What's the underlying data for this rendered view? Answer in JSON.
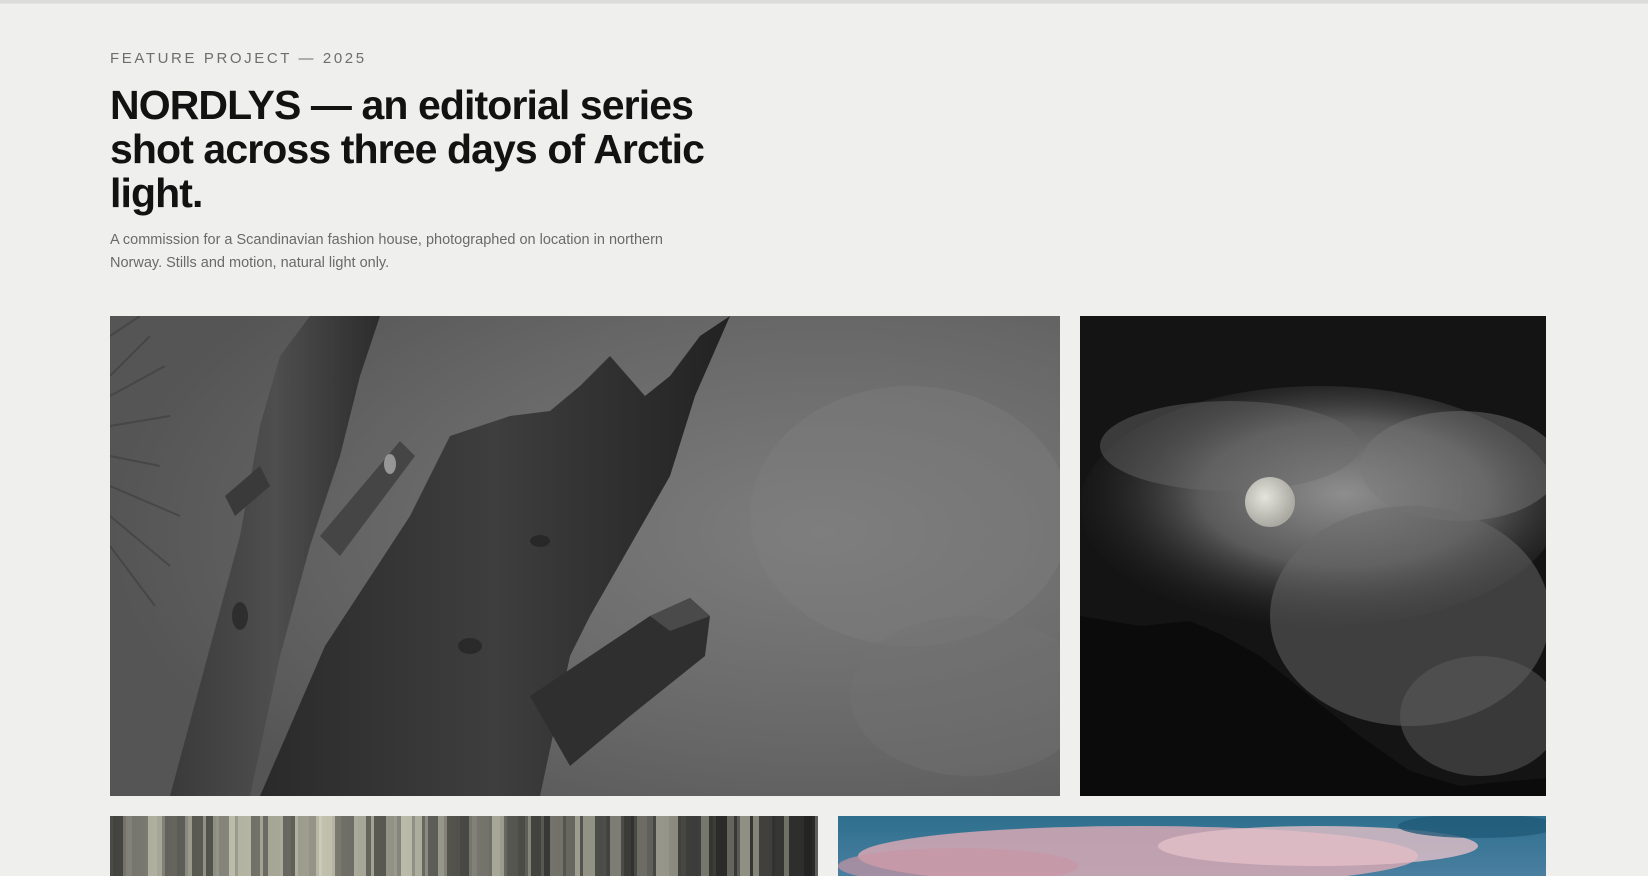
{
  "project": {
    "eyebrow": "FEATURE PROJECT — 2025",
    "title": "NORDLYS — an editorial series shot across three days of Arctic light.",
    "description": "A commission for a Scandinavian fashion house, photographed on location in northern Norway. Stills and motion, natural light only."
  },
  "gallery": {
    "images": [
      {
        "subject": "broken dead tree trunk, black and white"
      },
      {
        "subject": "moon behind clouds over dark mountain ridge"
      },
      {
        "subject": "motion-blurred forest trees"
      },
      {
        "subject": "pink and blue sunset clouds"
      }
    ]
  },
  "colors": {
    "background": "#efefed",
    "text": "#121212",
    "muted": "#6a6a67"
  }
}
